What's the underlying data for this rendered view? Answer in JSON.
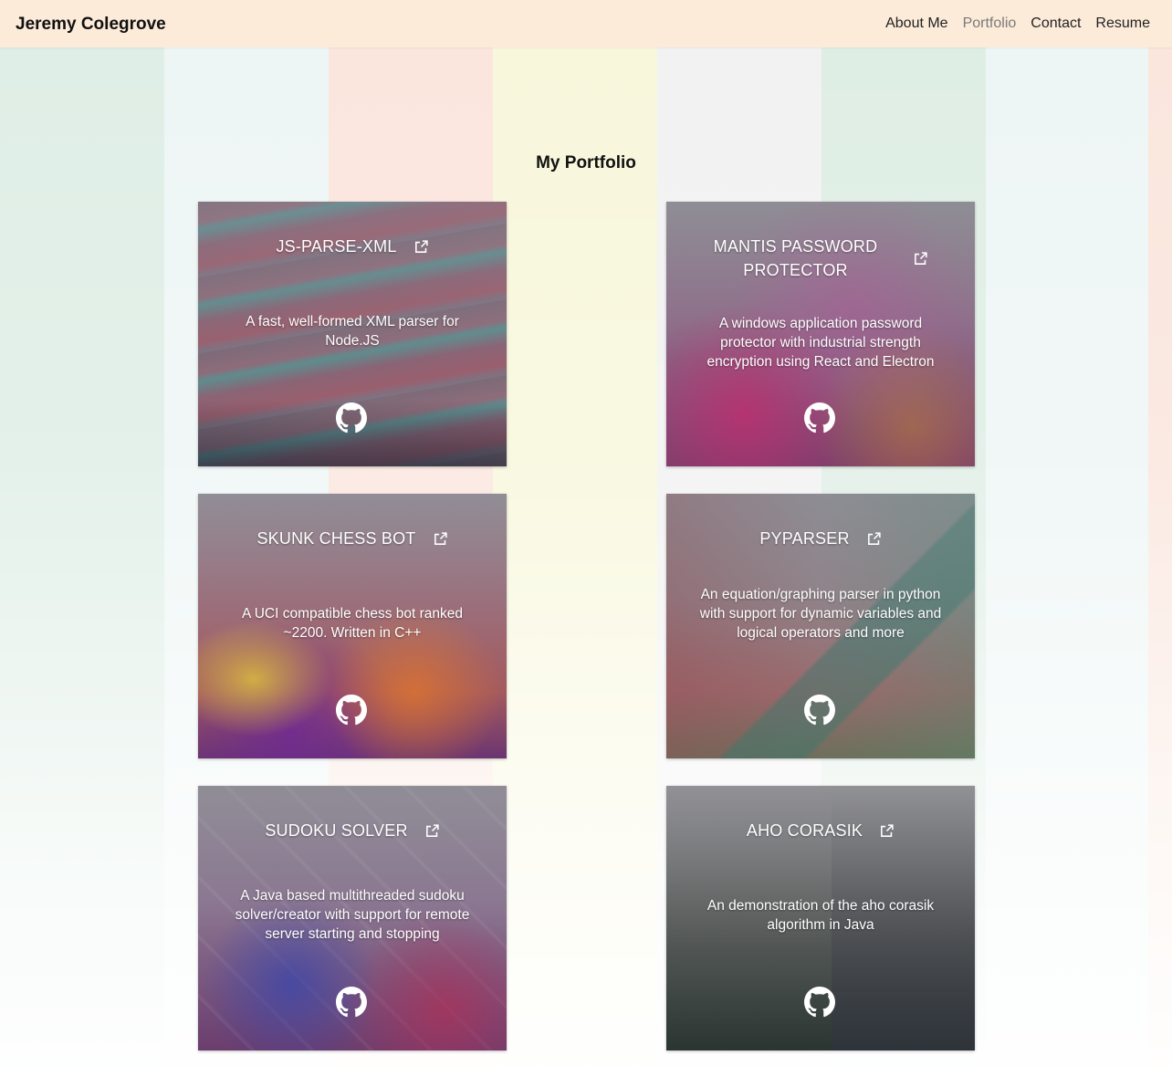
{
  "navbar": {
    "brand": "Jeremy Colegrove",
    "links": [
      {
        "label": "About Me",
        "active": false
      },
      {
        "label": "Portfolio",
        "active": true
      },
      {
        "label": "Contact",
        "active": false
      },
      {
        "label": "Resume",
        "active": false
      }
    ]
  },
  "main": {
    "title": "My Portfolio"
  },
  "projects": [
    {
      "title": "JS-PARSE-XML",
      "description": "A fast, well-formed XML parser for Node.JS"
    },
    {
      "title": "MANTIS PASSWORD PROTECTOR",
      "description": "A windows application password protector with industrial strength encryption using React and Electron"
    },
    {
      "title": "SKUNK CHESS BOT",
      "description": "A UCI compatible chess bot ranked ~2200. Written in C++"
    },
    {
      "title": "PYPARSER",
      "description": "An equation/graphing parser in python with support for dynamic variables and logical operators and more"
    },
    {
      "title": "SUDOKU SOLVER",
      "description": "A Java based multithreaded sudoku solver/creator with support for remote server starting and stopping"
    },
    {
      "title": "AHO CORASIK",
      "description": "An demonstration of the aho corasik algorithm in Java"
    }
  ],
  "icons": {
    "external_link": "external-link-icon",
    "github": "github-icon"
  },
  "colors": {
    "navbar_bg": "#fcebd9",
    "active_link": "#7a7a7a"
  }
}
